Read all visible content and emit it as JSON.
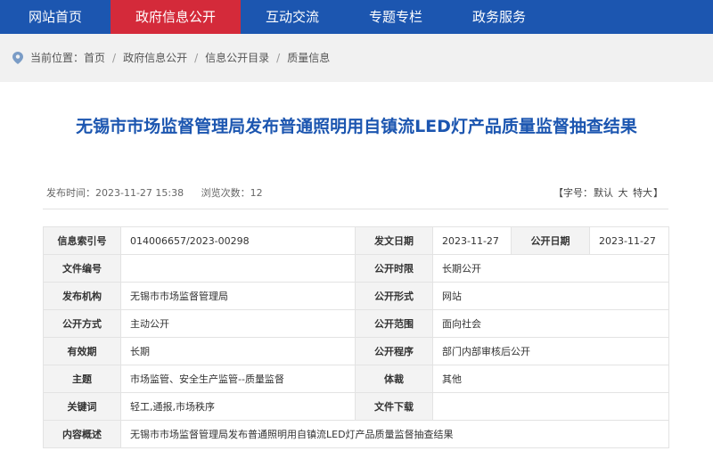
{
  "nav": {
    "items": [
      {
        "label": "网站首页"
      },
      {
        "label": "政府信息公开"
      },
      {
        "label": "互动交流"
      },
      {
        "label": "专题专栏"
      },
      {
        "label": "政务服务"
      }
    ],
    "active_color": "#d42a3a",
    "bar_color": "#1c56b0"
  },
  "breadcrumb": {
    "prefix": "当前位置：",
    "items": [
      "首页",
      "政府信息公开",
      "信息公开目录",
      "质量信息"
    ],
    "separator": "/",
    "icon": "location-pin-icon"
  },
  "article": {
    "title": "无锡市市场监督管理局发布普通照明用自镇流LED灯产品质量监督抽查结果",
    "publish_time": "发布时间：2023-11-27 15:38",
    "views": "浏览次数：12",
    "font_size": {
      "open": "【字号：",
      "default": "默认",
      "large": "大",
      "xlarge": "特大",
      "close": "】"
    }
  },
  "info_table": {
    "index_no_label": "信息索引号",
    "index_no": "014006657/2023-00298",
    "issue_date_label": "发文日期",
    "issue_date": "2023-11-27",
    "open_date_label": "公开日期",
    "open_date": "2023-11-27",
    "doc_no_label": "文件编号",
    "doc_no": "",
    "open_duration_label": "公开时限",
    "open_duration": "长期公开",
    "publisher_label": "发布机构",
    "publisher": "无锡市市场监督管理局",
    "open_form_label": "公开形式",
    "open_form": "网站",
    "open_method_label": "公开方式",
    "open_method": "主动公开",
    "open_scope_label": "公开范围",
    "open_scope": "面向社会",
    "validity_label": "有效期",
    "validity": "长期",
    "open_procedure_label": "公开程序",
    "open_procedure": "部门内部审核后公开",
    "topic_label": "主题",
    "topic": "市场监管、安全生产监管--质量监督",
    "genre_label": "体裁",
    "genre": "其他",
    "keywords_label": "关键词",
    "keywords": "轻工,通报,市场秩序",
    "download_label": "文件下载",
    "download": "",
    "summary_label": "内容概述",
    "summary": "无锡市市场监督管理局发布普通照明用自镇流LED灯产品质量监督抽查结果"
  }
}
